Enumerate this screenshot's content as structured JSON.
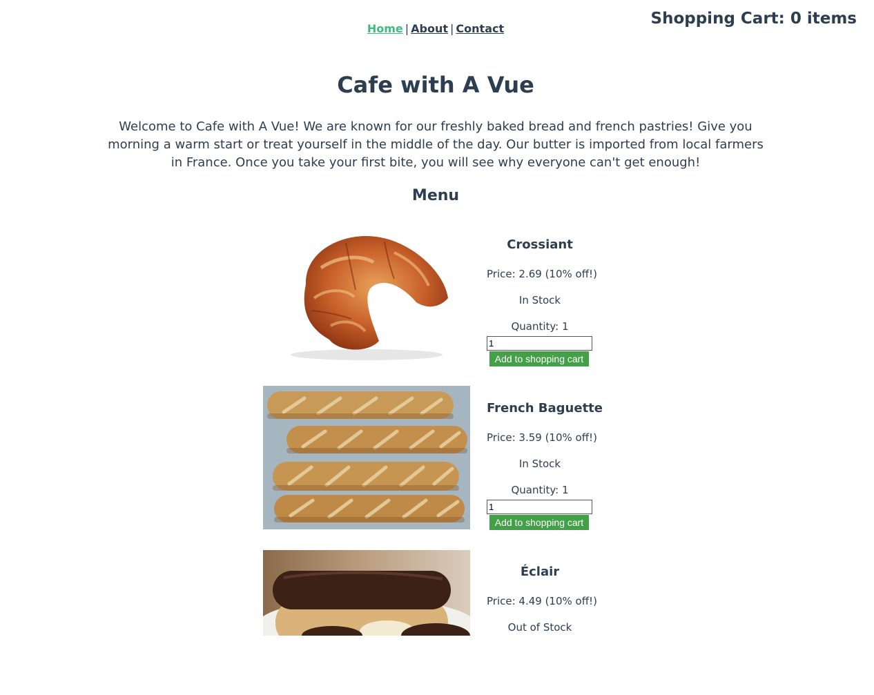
{
  "cart": {
    "label": "Shopping Cart: 0 items"
  },
  "nav": {
    "home": "Home",
    "about": "About",
    "contact": "Contact",
    "separator": "|",
    "active_color": "#42b983"
  },
  "page": {
    "title": "Cafe with A Vue",
    "intro": "Welcome to Cafe with A Vue! We are known for our freshly baked bread and french pastries! Give you morning a warm start or treat yourself in the middle of the day. Our butter is imported from local farmers in France. Once you take your first bite, you will see why everyone can't get enough!",
    "menu_heading": "Menu",
    "text_color": "#2c3e50"
  },
  "items": [
    {
      "name": "Crossiant",
      "price": "Price: 2.69 (10% off!)",
      "stock": "In Stock",
      "quantity_label": "Quantity: 1",
      "quantity_value": "1",
      "button_label": "Add to shopping cart",
      "image_icon": "croissant-image"
    },
    {
      "name": "French Baguette",
      "price": "Price: 3.59 (10% off!)",
      "stock": "In Stock",
      "quantity_label": "Quantity: 1",
      "quantity_value": "1",
      "button_label": "Add to shopping cart",
      "image_icon": "baguette-image"
    },
    {
      "name": "Éclair",
      "price": "Price: 4.49 (10% off!)",
      "stock": "Out of Stock",
      "image_icon": "eclair-image"
    }
  ],
  "button_color": "#43a047"
}
